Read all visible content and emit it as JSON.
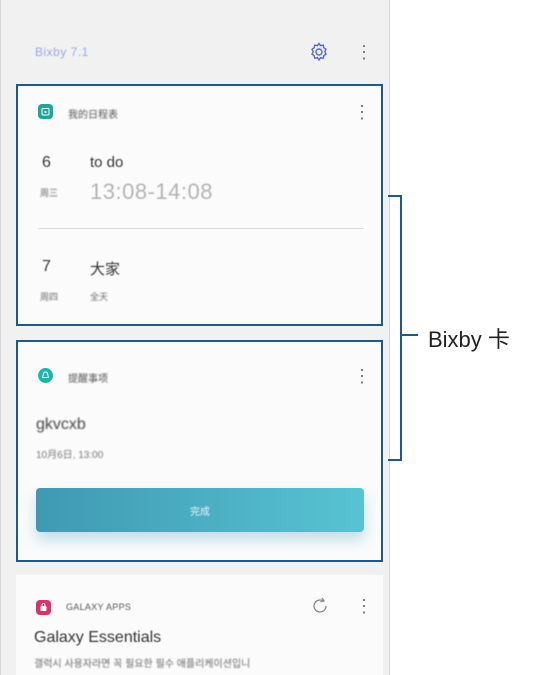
{
  "header": {
    "title": "Bixby 7.1"
  },
  "schedule_card": {
    "label": "我的日程表",
    "events": [
      {
        "day": "6",
        "weekday": "周三",
        "title": "to do",
        "time": "13:08-14:08"
      },
      {
        "day": "7",
        "weekday": "周四",
        "title": "大家",
        "time": "全天"
      }
    ]
  },
  "reminder_card": {
    "label": "提醒事项",
    "title": "gkvcxb",
    "time": "10月6日, 13:00",
    "button_label": "完成"
  },
  "galaxy_card": {
    "label": "GALAXY APPS",
    "title": "Galaxy Essentials",
    "description": "갤럭시 사용자라면 꼭 필요한 필수 애플리케이션입니"
  },
  "callout": {
    "label": "Bixby 卡"
  },
  "colors": {
    "accent_border": "#1c5a8c",
    "button_start": "#3f99b2",
    "button_end": "#57c3d3",
    "schedule_icon": "#19a79a",
    "reminder_icon": "#22b3b0"
  }
}
